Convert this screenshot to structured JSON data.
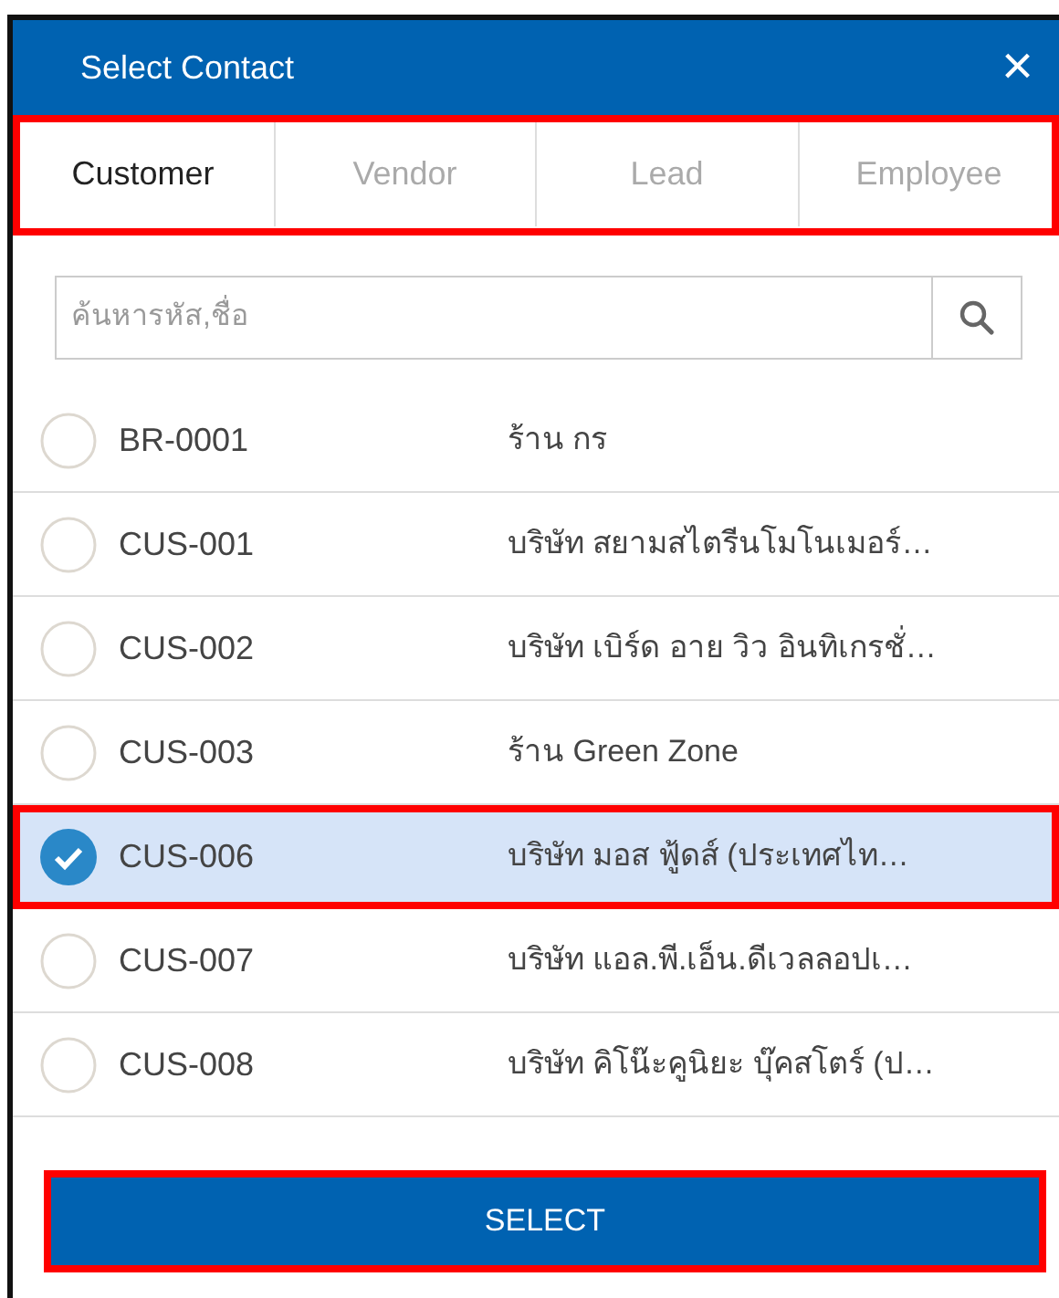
{
  "window": {
    "title": "Select Contact",
    "close": "×"
  },
  "tabs": [
    {
      "label": "Customer",
      "selected": true
    },
    {
      "label": "Vendor",
      "selected": false
    },
    {
      "label": "Lead",
      "selected": false
    },
    {
      "label": "Employee",
      "selected": false
    }
  ],
  "tabs_highlighted": true,
  "search": {
    "placeholder": "ค้นหารหัส,ชื่อ"
  },
  "contacts": [
    {
      "code": "BR-0001",
      "name": "ร้าน กร",
      "selected": false
    },
    {
      "code": "CUS-001",
      "name": "บริษัท สยามสไตรีนโมโนเมอร์…",
      "selected": false
    },
    {
      "code": "CUS-002",
      "name": "บริษัท เบิร์ด อาย วิว อินทิเกรชั่…",
      "selected": false
    },
    {
      "code": "CUS-003",
      "name": "ร้าน Green Zone",
      "selected": false
    },
    {
      "code": "CUS-006",
      "name": "บริษัท มอส ฟู้ดส์ (ประเทศไท…",
      "selected": true
    },
    {
      "code": "CUS-007",
      "name": "บริษัท แอล.พี.เอ็น.ดีเวลลอปเ…",
      "selected": false
    },
    {
      "code": "CUS-008",
      "name": "บริษัท คิโน๊ะคูนิยะ บุ๊คสโตร์ (ป…",
      "selected": false
    }
  ],
  "select_button": {
    "label": "SELECT",
    "highlighted": true
  }
}
